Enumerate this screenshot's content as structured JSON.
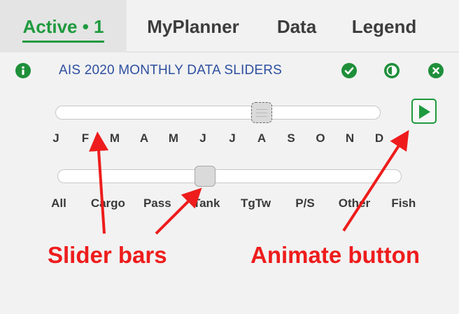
{
  "tabs": [
    {
      "label": "Active • 1",
      "active": true
    },
    {
      "label": "MyPlanner",
      "active": false
    },
    {
      "label": "Data",
      "active": false
    },
    {
      "label": "Legend",
      "active": false
    }
  ],
  "header": {
    "title": "AIS 2020 MONTHLY DATA SLIDERS",
    "icons": [
      "info-icon",
      "check-circle-icon",
      "contrast-icon",
      "close-circle-icon"
    ]
  },
  "month_slider": {
    "ticks": [
      "J",
      "F",
      "M",
      "A",
      "M",
      "J",
      "J",
      "A",
      "S",
      "O",
      "N",
      "D"
    ],
    "selected": "A"
  },
  "type_slider": {
    "ticks": [
      "All",
      "Cargo",
      "Pass",
      "Tank",
      "TgTw",
      "P/S",
      "Other",
      "Fish"
    ],
    "selected": "Tank"
  },
  "play_button": {
    "icon": "play-icon"
  },
  "annotations": {
    "slider_bars": "Slider bars",
    "animate_button": "Animate button"
  },
  "colors": {
    "accent_green": "#1f9a3e",
    "title_blue": "#2d4fa0",
    "annotation_red": "#ee1c1c",
    "background": "#f2f2f2"
  }
}
